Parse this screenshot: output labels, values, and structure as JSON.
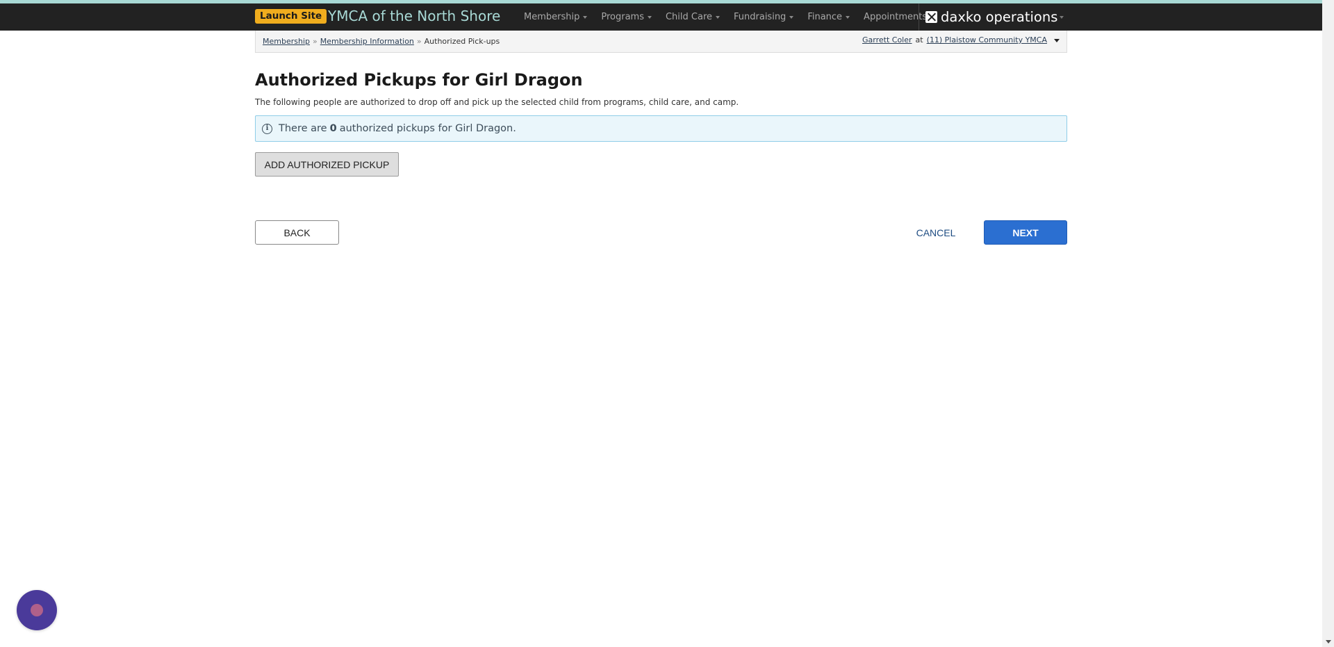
{
  "header": {
    "launch_badge": "Launch Site",
    "org_name": "YMCA of the North Shore",
    "menu": [
      {
        "label": "Membership"
      },
      {
        "label": "Programs"
      },
      {
        "label": "Child Care"
      },
      {
        "label": "Fundraising"
      },
      {
        "label": "Finance"
      },
      {
        "label": "Appointments"
      }
    ],
    "brand": "daxko operations",
    "brand_icon": "daxko-logo-icon"
  },
  "breadcrumb": {
    "items": [
      {
        "label": "Membership"
      },
      {
        "label": "Membership Information"
      }
    ],
    "current": "Authorized Pick-ups",
    "separator": "»"
  },
  "userbar": {
    "user": "Garrett Coler",
    "at": "at",
    "location": "(11) Plaistow Community YMCA"
  },
  "main": {
    "title": "Authorized Pickups for Girl Dragon",
    "description": "The following people are authorized to drop off and pick up the selected child from programs, child care, and camp.",
    "info": {
      "prefix": "There are",
      "count": "0",
      "suffix": "authorized pickups for Girl Dragon.",
      "icon": "info-icon"
    },
    "add_button": "ADD AUTHORIZED PICKUP",
    "back_button": "BACK",
    "cancel_button": "CANCEL",
    "next_button": "NEXT"
  },
  "colors": {
    "nav_bg": "#222222",
    "accent_teal": "#a8d9d5",
    "badge": "#f0ad1e",
    "primary": "#2b6fd1",
    "info_bg": "#eaf6fb",
    "info_border": "#8fcde8"
  }
}
